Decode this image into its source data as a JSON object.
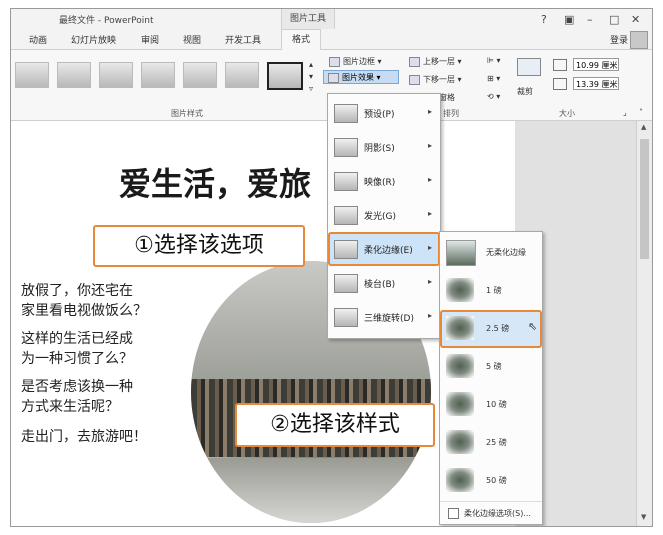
{
  "window": {
    "title": "最终文件 - PowerPoint",
    "context_tools": "图片工具",
    "controls": [
      "?",
      "▣",
      "–",
      "□",
      "✕"
    ]
  },
  "tabs": {
    "items": [
      "动画",
      "幻灯片放映",
      "审阅",
      "视图",
      "开发工具"
    ],
    "active": "格式",
    "login": "登录"
  },
  "ribbon": {
    "picture_styles_label": "图片样式",
    "picture_border": "图片边框",
    "picture_effects": "图片效果",
    "bring_forward": "上移一层",
    "send_backward": "下移一层",
    "selection_pane": "窗格",
    "arrange_label": "排列",
    "crop": "裁剪",
    "height": "10.99 厘米",
    "width": "13.39 厘米",
    "size_label": "大小"
  },
  "slide": {
    "title": "爱生活，爱旅",
    "lines": [
      [
        "放假了，你还宅在",
        "家里看电视做饭么？"
      ],
      [
        "这样的生活已经成",
        "为一种习惯了么？"
      ],
      [
        "是否考虑该换一种",
        "方式来生活呢？"
      ],
      [
        "走出门，去旅游吧！"
      ]
    ]
  },
  "callouts": {
    "step1": "①选择该选项",
    "step2": "②选择该样式"
  },
  "effects_menu": {
    "items": [
      {
        "label": "预设(P)"
      },
      {
        "label": "阴影(S)"
      },
      {
        "label": "映像(R)"
      },
      {
        "label": "发光(G)"
      },
      {
        "label": "柔化边缘(E)"
      },
      {
        "label": "棱台(B)"
      },
      {
        "label": "三维旋转(D)"
      }
    ],
    "highlighted": 4
  },
  "soft_edges_submenu": {
    "items": [
      "无柔化边缘",
      "1 磅",
      "2.5 磅",
      "5 磅",
      "10 磅",
      "25 磅",
      "50 磅"
    ],
    "selected": 2,
    "footer": "柔化边缘选项(S)..."
  },
  "colors": {
    "accent_orange": "#e8893a",
    "highlight_blue": "#cde3f7"
  }
}
